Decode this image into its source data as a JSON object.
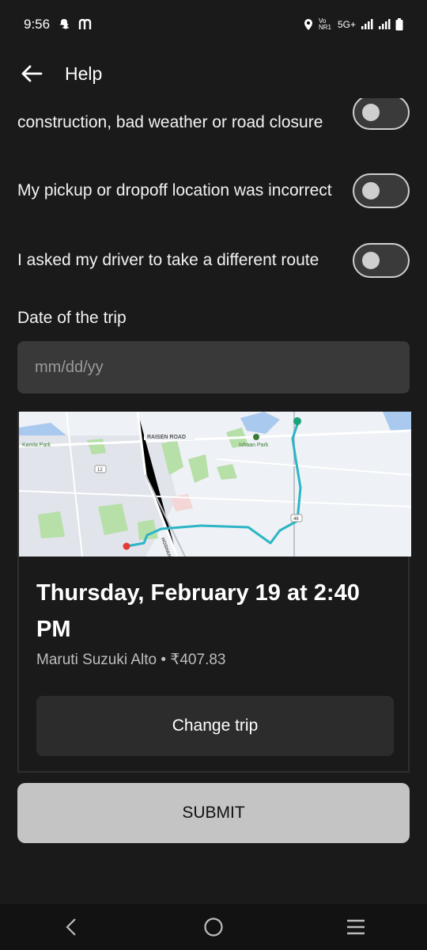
{
  "status_bar": {
    "time": "9:56",
    "network": "5G+",
    "volte": "Vo NR1"
  },
  "app_bar": {
    "title": "Help"
  },
  "toggles": [
    {
      "label": "construction, bad weather or road closure",
      "on": false
    },
    {
      "label": "My pickup or dropoff location was incorrect",
      "on": false
    },
    {
      "label": "I asked my driver to take a different route",
      "on": false
    }
  ],
  "date_section": {
    "label": "Date of the trip",
    "placeholder": "mm/dd/yy"
  },
  "map": {
    "road_label": "RAISEN ROAD",
    "park_left": "Kamla Park",
    "park_right": "Ishaan Park",
    "shield_12": "12",
    "shield_46": "46",
    "road_label_2": "HOSHAN",
    "route_color": "#2bb5c6"
  },
  "trip": {
    "title": "Thursday, February 19 at 2:40 PM",
    "subtitle": "Maruti Suzuki Alto • ₹407.83",
    "change_label": "Change trip"
  },
  "submit_label": "SUBMIT",
  "colors": {
    "background": "#1a1a1a",
    "submit": "#c4c4c4",
    "route": "#2bb5c6",
    "pickup": "#e53935",
    "dropoff": "#1aa37a"
  }
}
